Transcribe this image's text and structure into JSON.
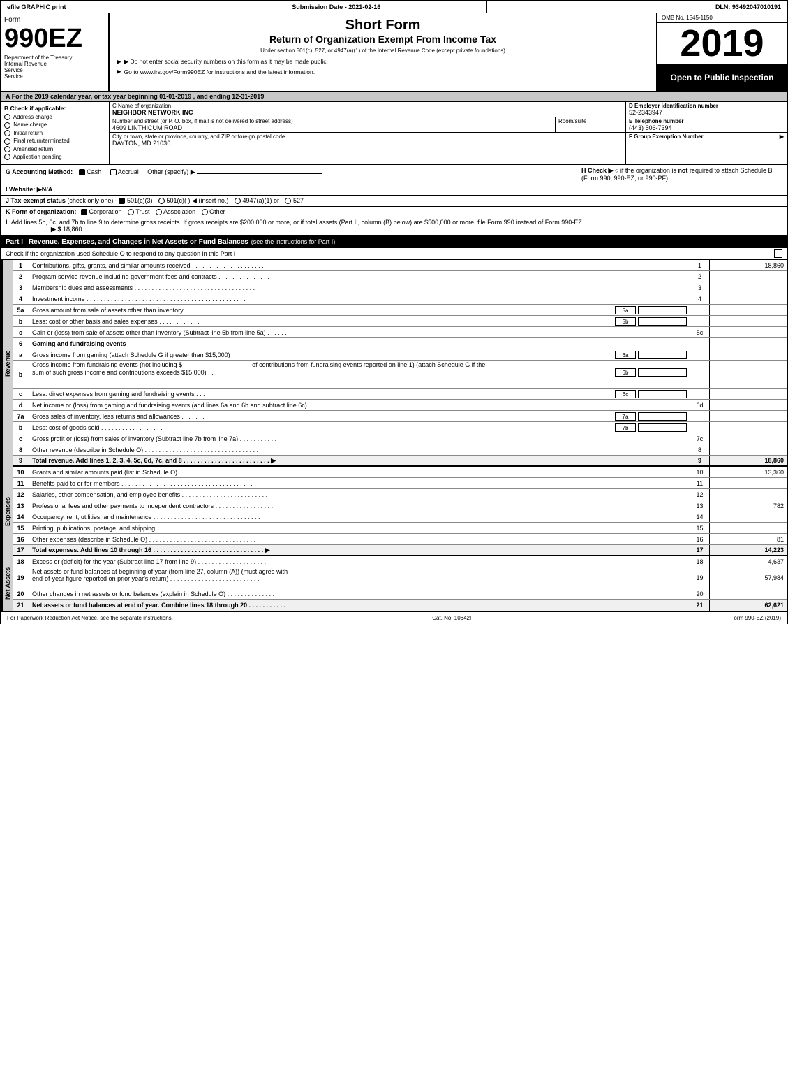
{
  "header": {
    "graphic": "efile GRAPHIC print",
    "submission_label": "Submission Date - 2021-02-16",
    "dln_label": "DLN: 93492047010191"
  },
  "form": {
    "number": "990EZ",
    "title_short": "Short Form",
    "title_main": "Return of Organization Exempt From Income Tax",
    "subtitle": "Under section 501(c), 527, or 4947(a)(1) of the Internal Revenue Code (except private foundations)",
    "note1": "▶ Do not enter social security numbers on this form as it may be made public.",
    "note2": "▶ Go to www.irs.gov/Form990EZ for instructions and the latest information.",
    "omb": "OMB No. 1545-1150",
    "year": "2019",
    "open_inspection": "Open to Public Inspection",
    "dept": "Department of the Treasury",
    "dept2": "Internal Revenue",
    "dept3": "Service"
  },
  "section_a": {
    "label": "A  For the 2019 calendar year, or tax year beginning 01-01-2019 , and ending 12-31-2019"
  },
  "check_b": {
    "label": "B  Check if applicable:",
    "items": [
      {
        "id": "address_change",
        "label": "Address charge",
        "checked": false
      },
      {
        "id": "name_change",
        "label": "Name charge",
        "checked": false
      },
      {
        "id": "initial_return",
        "label": "Initial return",
        "checked": false
      },
      {
        "id": "final_return",
        "label": "Final return/terminated",
        "checked": false
      },
      {
        "id": "amended",
        "label": "Amended return",
        "checked": false
      },
      {
        "id": "app_pending",
        "label": "Application pending",
        "checked": false
      }
    ]
  },
  "org": {
    "name_label": "C Name of organization",
    "name_value": "NEIGHBOR NETWORK INC",
    "street_label": "Number and street (or P. O. box, if mail is not delivered to street address)",
    "street_value": "4609 LINTHICUM ROAD",
    "room_label": "Room/suite",
    "city_label": "City or town, state or province, country, and ZIP or foreign postal code",
    "city_value": "DAYTON, MD  21036",
    "ein_label": "D Employer identification number",
    "ein_value": "52-2343947",
    "tel_label": "E Telephone number",
    "tel_value": "(443) 506-7394",
    "group_label": "F Group Exemption Number",
    "group_value": "▶"
  },
  "section_g": {
    "label": "G Accounting Method:",
    "cash": "Cash",
    "accrual": "Accrual",
    "other": "Other (specify) ▶"
  },
  "section_h": {
    "label": "H  Check ▶",
    "text": "○ if the organization is not required to attach Schedule B (Form 990, 990-EZ, or 990-PF)."
  },
  "section_i": {
    "label": "I Website: ▶N/A"
  },
  "section_j": {
    "label": "J Tax-exempt status (check only one) -",
    "options": "☑ 501(c)(3) ○ 501(c)(   ) ◀ (insert no.) ○ 4947(a)(1) or ○ 527"
  },
  "section_k": {
    "label": "K Form of organization:",
    "options": "☑ Corporation  ○ Trust  ○ Association  ○ Other"
  },
  "section_l": {
    "text": "L Add lines 5b, 6c, and 7b to line 9 to determine gross receipts. If gross receipts are $200,000 or more, or if total assets (Part II, column (B) below) are $500,000 or more, file Form 990 instead of Form 990-EZ",
    "dots": ". . . . . . . . . . . . . . . . . . . . . . . . . . . . . . . . . . . .",
    "arrow": "▶ $",
    "value": "18,860"
  },
  "part1": {
    "header": "Part I",
    "title": "Revenue, Expenses, and Changes in Net Assets or Fund Balances",
    "subtitle": "(see the instructions for Part I)",
    "check_text": "Check if the organization used Schedule O to respond to any question in this Part I",
    "rows": [
      {
        "num": "1",
        "desc": "Contributions, gifts, grants, and similar amounts received . . . . . . . . . . . . . . . . . . . . .",
        "line": "1",
        "amount": "18,860"
      },
      {
        "num": "2",
        "desc": "Program service revenue including government fees and contracts . . . . . . . . . . . . . . .",
        "line": "2",
        "amount": ""
      },
      {
        "num": "3",
        "desc": "Membership dues and assessments . . . . . . . . . . . . . . . . . . . . . . . . . . . . . . . . . . .",
        "line": "3",
        "amount": ""
      },
      {
        "num": "4",
        "desc": "Investment income . . . . . . . . . . . . . . . . . . . . . . . . . . . . . . . . . . . . . . . . . . . . . .",
        "line": "4",
        "amount": ""
      }
    ],
    "row5a": {
      "num": "5a",
      "desc": "Gross amount from sale of assets other than inventory . . . . . . .",
      "sub_label": "5a",
      "amount": ""
    },
    "row5b": {
      "num": "b",
      "desc": "Less: cost or other basis and sales expenses . . . . . . . . . . . .",
      "sub_label": "5b",
      "amount": ""
    },
    "row5c": {
      "num": "c",
      "desc": "Gain or (loss) from sale of assets other than inventory (Subtract line 5b from line 5a) . . . . . .",
      "line": "5c",
      "amount": ""
    },
    "row6": {
      "num": "6",
      "desc": "Gaming and fundraising events"
    },
    "row6a": {
      "num": "a",
      "desc": "Gross income from gaming (attach Schedule G if greater than $15,000)",
      "sub_label": "6a",
      "amount": ""
    },
    "row6b_desc": "Gross income from fundraising events (not including $",
    "row6b_desc2": "of contributions from fundraising events reported on line 1) (attach Schedule G if the sum of such gross income and contributions exceeds $15,000)",
    "row6b": {
      "sub_label": "6b",
      "amount": ""
    },
    "row6c": {
      "num": "c",
      "desc": "Less: direct expenses from gaming and fundraising events   .  .  .",
      "sub_label": "6c",
      "amount": ""
    },
    "row6d": {
      "num": "d",
      "desc": "Net income or (loss) from gaming and fundraising events (add lines 6a and 6b and subtract line 6c)",
      "line": "6d",
      "amount": ""
    },
    "row7a": {
      "num": "7a",
      "desc": "Gross sales of inventory, less returns and allowances . . . . . . .",
      "sub_label": "7a",
      "amount": ""
    },
    "row7b": {
      "num": "b",
      "desc": "Less: cost of goods sold  .  .  .  .  .  .  .  .  .  .  .  .  .  .  .  .  .  .  .",
      "sub_label": "7b",
      "amount": ""
    },
    "row7c": {
      "num": "c",
      "desc": "Gross profit or (loss) from sales of inventory (Subtract line 7b from line 7a) . . . . . . . . . . .",
      "line": "7c",
      "amount": ""
    },
    "row8": {
      "num": "8",
      "desc": "Other revenue (describe in Schedule O) . . . . . . . . . . . . . . . . . . . . . . . . . . . . . . . . .",
      "line": "8",
      "amount": ""
    },
    "row9": {
      "num": "9",
      "desc": "Total revenue. Add lines 1, 2, 3, 4, 5c, 6d, 7c, and 8 . . . . . . . . . . . . . . . . . . . . . . . .",
      "line": "9",
      "amount": "18,860"
    }
  },
  "expenses": {
    "rows": [
      {
        "num": "10",
        "desc": "Grants and similar amounts paid (list in Schedule O) . . . . . . . . . . . . . . . . . . . . . . . . .",
        "line": "10",
        "amount": "13,360"
      },
      {
        "num": "11",
        "desc": "Benefits paid to or for members . . . . . . . . . . . . . . . . . . . . . . . . . . . . . . . . . . . . . .",
        "line": "11",
        "amount": ""
      },
      {
        "num": "12",
        "desc": "Salaries, other compensation, and employee benefits . . . . . . . . . . . . . . . . . . . . . . . . .",
        "line": "12",
        "amount": ""
      },
      {
        "num": "13",
        "desc": "Professional fees and other payments to independent contractors . . . . . . . . . . . . . . . . .",
        "line": "13",
        "amount": "782"
      },
      {
        "num": "14",
        "desc": "Occupancy, rent, utilities, and maintenance . . . . . . . . . . . . . . . . . . . . . . . . . . . . . . .",
        "line": "14",
        "amount": ""
      },
      {
        "num": "15",
        "desc": "Printing, publications, postage, and shipping. . . . . . . . . . . . . . . . . . . . . . . . . . . . . .",
        "line": "15",
        "amount": ""
      },
      {
        "num": "16",
        "desc": "Other expenses (describe in Schedule O) . . . . . . . . . . . . . . . . . . . . . . . . . . . . . . .",
        "line": "16",
        "amount": "81"
      },
      {
        "num": "17",
        "desc": "Total expenses. Add lines 10 through 16  . . . . . . . . . . . . . . . . . . . . . . . . . . . . . . . .",
        "line": "17",
        "amount": "14,223",
        "bold": true
      }
    ]
  },
  "net_assets": {
    "rows": [
      {
        "num": "18",
        "desc": "Excess or (deficit) for the year (Subtract line 17 from line 9) . . . . . . . . . . . . . . . . . . . .",
        "line": "18",
        "amount": "4,637"
      },
      {
        "num": "19",
        "desc": "Net assets or fund balances at beginning of year (from line 27, column (A)) (must agree with end-of-year figure reported on prior year's return) . . . . . . . . . . . . . . . . . . . . . . . . . .",
        "line": "19",
        "amount": "57,984"
      },
      {
        "num": "20",
        "desc": "Other changes in net assets or fund balances (explain in Schedule O) . . . . . . . . . . . . . .",
        "line": "20",
        "amount": ""
      },
      {
        "num": "21",
        "desc": "Net assets or fund balances at end of year. Combine lines 18 through 20 . . . . . . . . . . .",
        "line": "21",
        "amount": "62,621",
        "bold": true
      }
    ]
  },
  "footer": {
    "left": "For Paperwork Reduction Act Notice, see the separate instructions.",
    "center": "Cat. No. 10642I",
    "right": "Form 990-EZ (2019)"
  }
}
